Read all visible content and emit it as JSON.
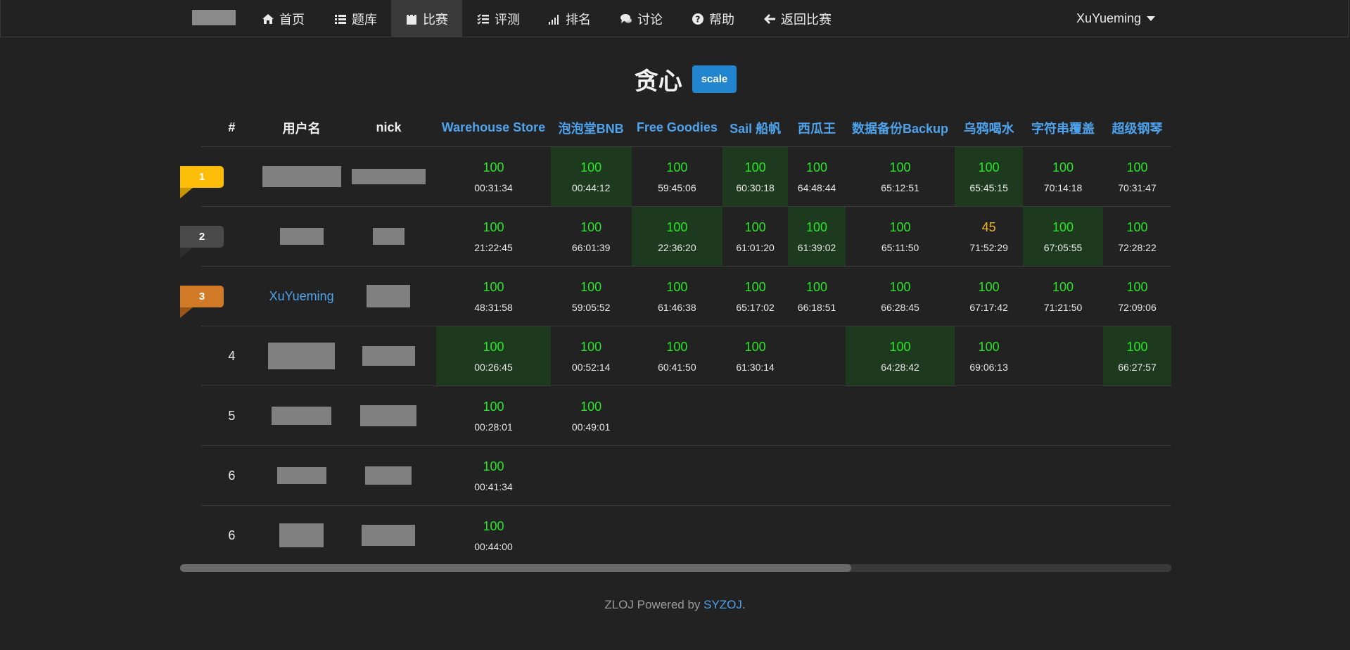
{
  "nav": {
    "items": [
      {
        "label": "首页",
        "icon": "home-icon"
      },
      {
        "label": "题库",
        "icon": "list-icon"
      },
      {
        "label": "比赛",
        "icon": "calendar-icon"
      },
      {
        "label": "评测",
        "icon": "tasks-icon"
      },
      {
        "label": "排名",
        "icon": "signal-icon"
      },
      {
        "label": "讨论",
        "icon": "comments-icon"
      },
      {
        "label": "帮助",
        "icon": "question-icon"
      },
      {
        "label": "返回比赛",
        "icon": "arrow-left-icon"
      }
    ],
    "active": "比赛",
    "user": "XuYueming"
  },
  "page": {
    "title": "贪心",
    "badge": "scale"
  },
  "table": {
    "headers": [
      "#",
      "用户名",
      "nick"
    ],
    "problems": [
      "Warehouse Store",
      "泡泡堂BNB",
      "Free Goodies",
      "Sail 船帆",
      "西瓜王",
      "数据备份Backup",
      "乌鸦喝水",
      "字符串覆盖",
      "超级钢琴"
    ],
    "rows": [
      {
        "rank": "1",
        "username": "",
        "cells": [
          {
            "score": "100",
            "time": "00:31:34",
            "first": false
          },
          {
            "score": "100",
            "time": "00:44:12",
            "first": true
          },
          {
            "score": "100",
            "time": "59:45:06",
            "first": false
          },
          {
            "score": "100",
            "time": "60:30:18",
            "first": true
          },
          {
            "score": "100",
            "time": "64:48:44",
            "first": false
          },
          {
            "score": "100",
            "time": "65:12:51",
            "first": false
          },
          {
            "score": "100",
            "time": "65:45:15",
            "first": true
          },
          {
            "score": "100",
            "time": "70:14:18",
            "first": false
          },
          {
            "score": "100",
            "time": "70:31:47",
            "first": false
          }
        ]
      },
      {
        "rank": "2",
        "username": "",
        "cells": [
          {
            "score": "100",
            "time": "21:22:45",
            "first": false
          },
          {
            "score": "100",
            "time": "66:01:39",
            "first": false
          },
          {
            "score": "100",
            "time": "22:36:20",
            "first": true
          },
          {
            "score": "100",
            "time": "61:01:20",
            "first": false
          },
          {
            "score": "100",
            "time": "61:39:02",
            "first": true
          },
          {
            "score": "100",
            "time": "65:11:50",
            "first": false
          },
          {
            "score": "45",
            "time": "71:52:29",
            "first": false
          },
          {
            "score": "100",
            "time": "67:05:55",
            "first": true
          },
          {
            "score": "100",
            "time": "72:28:22",
            "first": false
          }
        ]
      },
      {
        "rank": "3",
        "username": "XuYueming",
        "cells": [
          {
            "score": "100",
            "time": "48:31:58",
            "first": false
          },
          {
            "score": "100",
            "time": "59:05:52",
            "first": false
          },
          {
            "score": "100",
            "time": "61:46:38",
            "first": false
          },
          {
            "score": "100",
            "time": "65:17:02",
            "first": false
          },
          {
            "score": "100",
            "time": "66:18:51",
            "first": false
          },
          {
            "score": "100",
            "time": "66:28:45",
            "first": false
          },
          {
            "score": "100",
            "time": "67:17:42",
            "first": false
          },
          {
            "score": "100",
            "time": "71:21:50",
            "first": false
          },
          {
            "score": "100",
            "time": "72:09:06",
            "first": false
          }
        ]
      },
      {
        "rank": "4",
        "username": "",
        "cells": [
          {
            "score": "100",
            "time": "00:26:45",
            "first": true
          },
          {
            "score": "100",
            "time": "00:52:14",
            "first": false
          },
          {
            "score": "100",
            "time": "60:41:50",
            "first": false
          },
          {
            "score": "100",
            "time": "61:30:14",
            "first": false
          },
          null,
          {
            "score": "100",
            "time": "64:28:42",
            "first": true
          },
          {
            "score": "100",
            "time": "69:06:13",
            "first": false
          },
          null,
          {
            "score": "100",
            "time": "66:27:57",
            "first": true
          }
        ]
      },
      {
        "rank": "5",
        "username": "",
        "cells": [
          {
            "score": "100",
            "time": "00:28:01",
            "first": false
          },
          {
            "score": "100",
            "time": "00:49:01",
            "first": false
          },
          null,
          null,
          null,
          null,
          null,
          null,
          null
        ]
      },
      {
        "rank": "6",
        "username": "",
        "cells": [
          {
            "score": "100",
            "time": "00:41:34",
            "first": false
          },
          null,
          null,
          null,
          null,
          null,
          null,
          null,
          null
        ]
      },
      {
        "rank": "6",
        "username": "",
        "cells": [
          {
            "score": "100",
            "time": "00:44:00",
            "first": false
          },
          null,
          null,
          null,
          null,
          null,
          null,
          null,
          null
        ]
      }
    ]
  },
  "footer": {
    "text": "ZLOJ Powered by ",
    "link": "SYZOJ",
    "suffix": "."
  }
}
